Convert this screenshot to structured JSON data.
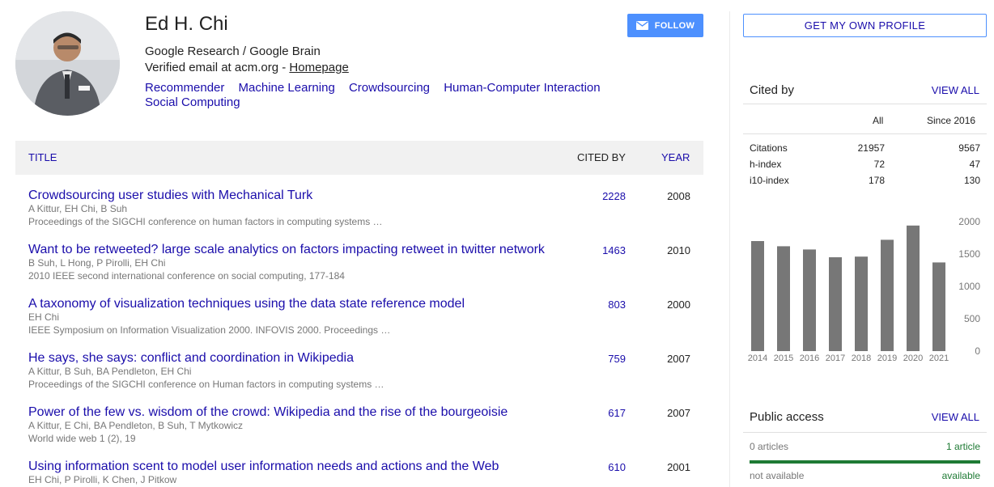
{
  "profile": {
    "name": "Ed H. Chi",
    "affiliation": "Google Research / Google Brain",
    "email_text": "Verified email at acm.org - ",
    "homepage_label": "Homepage",
    "interests": [
      "Recommender",
      "Machine Learning",
      "Crowdsourcing",
      "Human-Computer Interaction",
      "Social Computing"
    ],
    "follow_label": "FOLLOW"
  },
  "table": {
    "header": {
      "title": "TITLE",
      "cited_by": "CITED BY",
      "year": "YEAR"
    },
    "rows": [
      {
        "title": "Crowdsourcing user studies with Mechanical Turk",
        "authors": "A Kittur, EH Chi, B Suh",
        "venue": "Proceedings of the SIGCHI conference on human factors in computing systems …",
        "cited_by": "2228",
        "year": "2008"
      },
      {
        "title": "Want to be retweeted? large scale analytics on factors impacting retweet in twitter network",
        "authors": "B Suh, L Hong, P Pirolli, EH Chi",
        "venue": "2010 IEEE second international conference on social computing, 177-184",
        "cited_by": "1463",
        "year": "2010"
      },
      {
        "title": "A taxonomy of visualization techniques using the data state reference model",
        "authors": "EH Chi",
        "venue": "IEEE Symposium on Information Visualization 2000. INFOVIS 2000. Proceedings …",
        "cited_by": "803",
        "year": "2000"
      },
      {
        "title": "He says, she says: conflict and coordination in Wikipedia",
        "authors": "A Kittur, B Suh, BA Pendleton, EH Chi",
        "venue": "Proceedings of the SIGCHI conference on Human factors in computing systems …",
        "cited_by": "759",
        "year": "2007"
      },
      {
        "title": "Power of the few vs. wisdom of the crowd: Wikipedia and the rise of the bourgeoisie",
        "authors": "A Kittur, E Chi, BA Pendleton, B Suh, T Mytkowicz",
        "venue": "World wide web 1 (2), 19",
        "cited_by": "617",
        "year": "2007"
      },
      {
        "title": "Using information scent to model user information needs and actions and the Web",
        "authors": "EH Chi, P Pirolli, K Chen, J Pitkow",
        "venue": "",
        "cited_by": "610",
        "year": "2001"
      }
    ]
  },
  "sidebar": {
    "own_profile_label": "GET MY OWN PROFILE",
    "cited_by": {
      "heading": "Cited by",
      "view_all": "VIEW ALL",
      "col_all": "All",
      "col_since": "Since 2016",
      "rows": [
        {
          "label": "Citations",
          "all": "21957",
          "since": "9567"
        },
        {
          "label": "h-index",
          "all": "72",
          "since": "47"
        },
        {
          "label": "i10-index",
          "all": "178",
          "since": "130"
        }
      ]
    },
    "public_access": {
      "heading": "Public access",
      "view_all": "VIEW ALL",
      "left_count": "0 articles",
      "right_count": "1 article",
      "left_label": "not available",
      "right_label": "available",
      "available_color": "#1e7a34"
    }
  },
  "chart_data": {
    "type": "bar",
    "categories": [
      "2014",
      "2015",
      "2016",
      "2017",
      "2018",
      "2019",
      "2020",
      "2021"
    ],
    "values": [
      1700,
      1620,
      1570,
      1450,
      1460,
      1720,
      1940,
      1370
    ],
    "yticks": [
      "2000",
      "1500",
      "1000",
      "500",
      "0"
    ],
    "ylim": [
      0,
      2000
    ],
    "bar_color": "#777777",
    "xlabel": "",
    "ylabel": "",
    "title": ""
  }
}
